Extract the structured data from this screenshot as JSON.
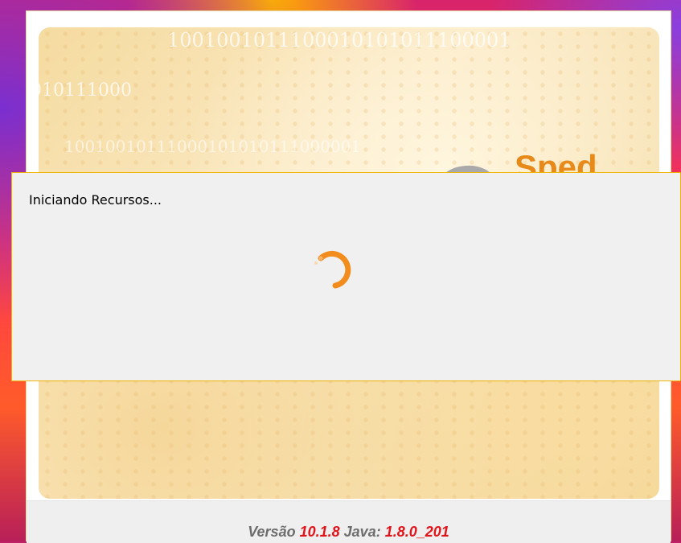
{
  "splash": {
    "binary_lines": [
      "1001001011100010101011100001",
      "010111000",
      "10010010111000101010111000001"
    ],
    "logo_text": "Sped",
    "version_label": "Versão",
    "version_value": "10.1.8",
    "java_label": "Java:",
    "java_value": "1.8.0_201"
  },
  "dialog": {
    "status_text": "Iniciando Recursos..."
  },
  "colors": {
    "accent_orange": "#f28c1c",
    "version_red": "#e0141a",
    "dialog_border": "#f0b400"
  },
  "icons": {
    "spinner": "loading-spinner-icon"
  }
}
